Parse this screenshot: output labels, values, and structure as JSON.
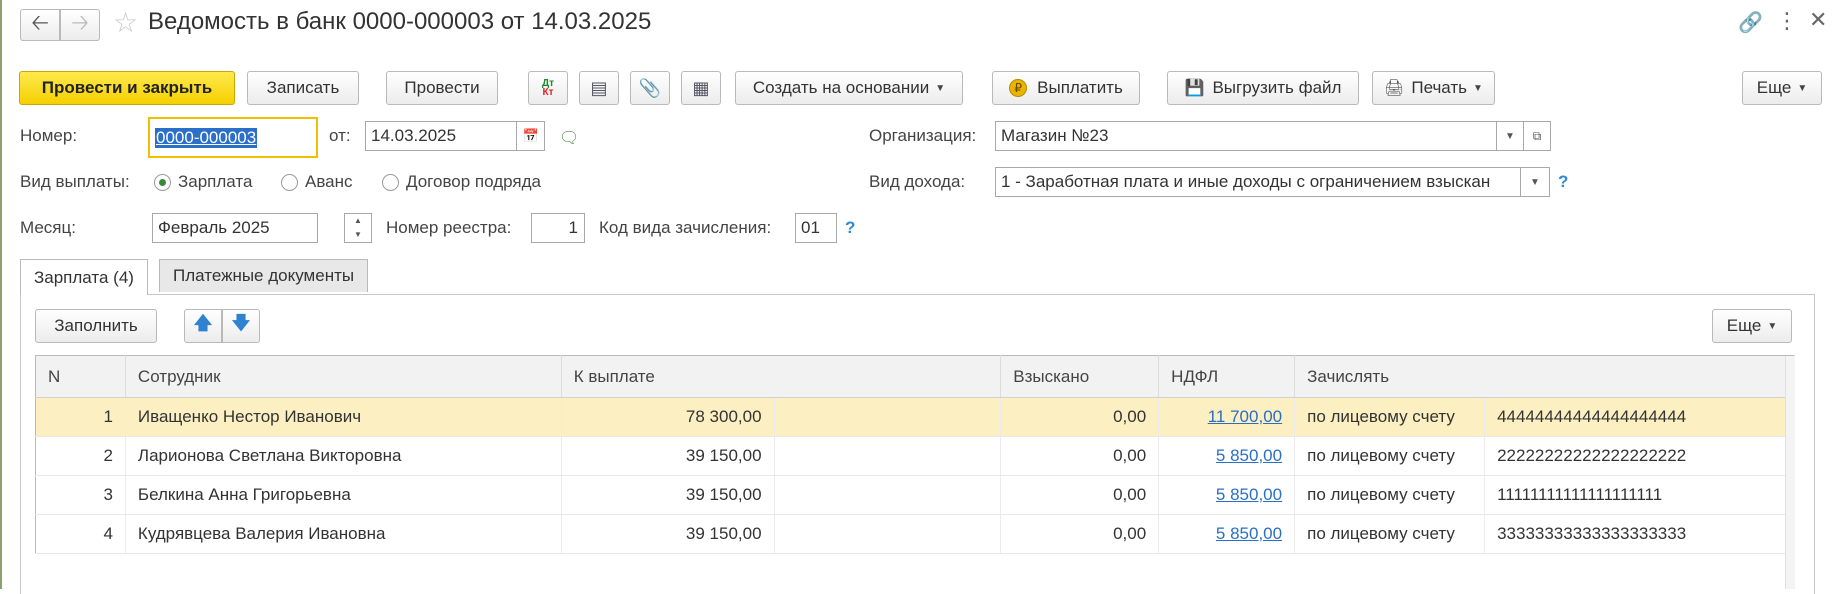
{
  "window": {
    "title": "Ведомость в банк 0000-000003 от 14.03.2025"
  },
  "toolbar": {
    "post_close": "Провести и закрыть",
    "save": "Записать",
    "post": "Провести",
    "create_based": "Создать на основании",
    "pay": "Выплатить",
    "export_file": "Выгрузить файл",
    "print": "Печать",
    "more": "Еще"
  },
  "form": {
    "number_label": "Номер:",
    "number_value": "0000-000003",
    "from_label": "от:",
    "date_value": "14.03.2025",
    "org_label": "Организация:",
    "org_value": "Магазин №23",
    "payment_type_label": "Вид выплаты:",
    "payment_options": [
      "Зарплата",
      "Аванс",
      "Договор подряда"
    ],
    "income_type_label": "Вид дохода:",
    "income_type_value": "1 - Заработная плата и иные доходы с ограничением взыскан",
    "month_label": "Месяц:",
    "month_value": "Февраль 2025",
    "registry_label": "Номер реестра:",
    "registry_value": "1",
    "accrual_code_label": "Код вида зачисления:",
    "accrual_code_value": "01",
    "help": "?"
  },
  "tabs": [
    "Зарплата (4)",
    "Платежные документы"
  ],
  "table_toolbar": {
    "fill": "Заполнить",
    "more": "Еще"
  },
  "table": {
    "columns": [
      "N",
      "Сотрудник",
      "К выплате",
      "Взыскано",
      "НДФЛ",
      "Зачислять"
    ],
    "rows": [
      {
        "n": "1",
        "employee": "Иващенко Нестор Иванович",
        "amount": "78 300,00",
        "recovered": "0,00",
        "ndfl": "11 700,00",
        "credit": "по лицевому счету",
        "account": "44444444444444444444"
      },
      {
        "n": "2",
        "employee": "Ларионова Светлана Викторовна",
        "amount": "39 150,00",
        "recovered": "0,00",
        "ndfl": "5 850,00",
        "credit": "по лицевому счету",
        "account": "22222222222222222222"
      },
      {
        "n": "3",
        "employee": "Белкина Анна Григорьевна",
        "amount": "39 150,00",
        "recovered": "0,00",
        "ndfl": "5 850,00",
        "credit": "по лицевому счету",
        "account": "11111111111111111111"
      },
      {
        "n": "4",
        "employee": "Кудрявцева Валерия Ивановна",
        "amount": "39 150,00",
        "recovered": "0,00",
        "ndfl": "5 850,00",
        "credit": "по лицевому счету",
        "account": "33333333333333333333"
      }
    ]
  },
  "colors": {
    "primary_button": "#f5d000",
    "selected_row": "#fcefc2",
    "link": "#2a6fc4",
    "focus_border": "#f0c000"
  }
}
